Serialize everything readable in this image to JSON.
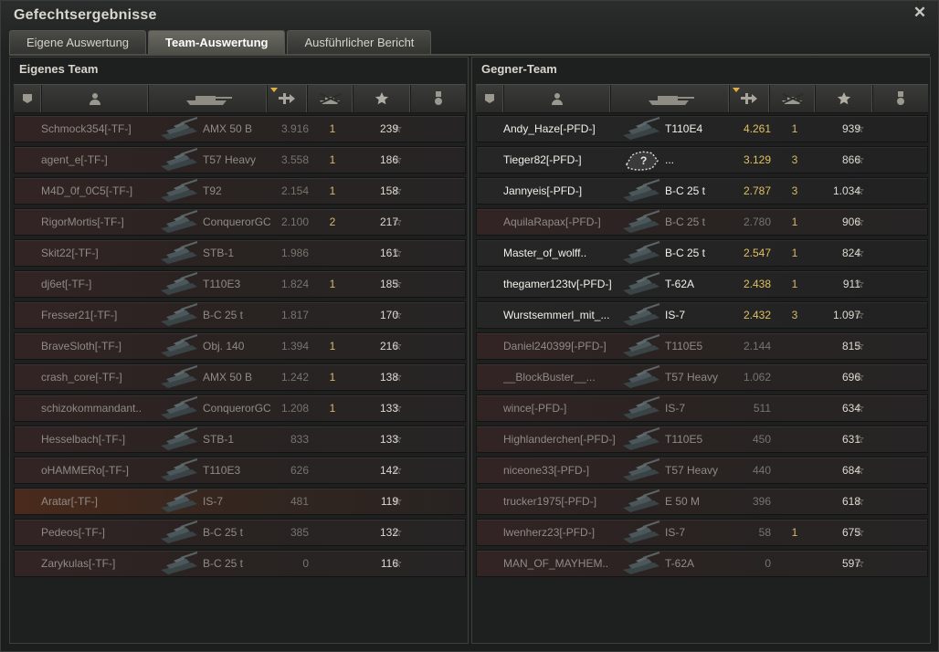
{
  "window": {
    "title": "Gefechtsergebnisse"
  },
  "tabs": [
    {
      "label": "Eigene Auswertung"
    },
    {
      "label": "Team-Auswertung"
    },
    {
      "label": "Ausführlicher Bericht"
    }
  ],
  "active_tab": "Team-Auswertung",
  "icons": {
    "close": "close-icon",
    "columns": [
      "squad-icon",
      "player-icon",
      "tank-icon",
      "damage-icon",
      "kills-icon",
      "xp-star-icon",
      "medal-icon"
    ],
    "row_star": "star-icon"
  },
  "colors": {
    "accent_gold": "#e0c060",
    "sort_indicator": "#e0b040"
  },
  "own_team": {
    "title": "Eigenes Team",
    "sorted_column": "damage",
    "rows": [
      {
        "name": "Schmock354[-TF-]",
        "tank": "AMX 50 B",
        "damage": "3.916",
        "kills": "1",
        "xp": "239",
        "alive": false,
        "self": false
      },
      {
        "name": "agent_e[-TF-]",
        "tank": "T57 Heavy",
        "damage": "3.558",
        "kills": "1",
        "xp": "186",
        "alive": false,
        "self": false
      },
      {
        "name": "M4D_0f_0C5[-TF-]",
        "tank": "T92",
        "damage": "2.154",
        "kills": "1",
        "xp": "158",
        "alive": false,
        "self": false
      },
      {
        "name": "RigorMortis[-TF-]",
        "tank": "ConquerorGC",
        "damage": "2.100",
        "kills": "2",
        "xp": "217",
        "alive": false,
        "self": false
      },
      {
        "name": "Skit22[-TF-]",
        "tank": "STB-1",
        "damage": "1.986",
        "kills": "",
        "xp": "161",
        "alive": false,
        "self": false
      },
      {
        "name": "dj6et[-TF-]",
        "tank": "T110E3",
        "damage": "1.824",
        "kills": "1",
        "xp": "185",
        "alive": false,
        "self": false
      },
      {
        "name": "Fresser21[-TF-]",
        "tank": "B-C 25 t",
        "damage": "1.817",
        "kills": "",
        "xp": "170",
        "alive": false,
        "self": false
      },
      {
        "name": "BraveSloth[-TF-]",
        "tank": "Obj. 140",
        "damage": "1.394",
        "kills": "1",
        "xp": "216",
        "alive": false,
        "self": false
      },
      {
        "name": "crash_core[-TF-]",
        "tank": "AMX 50 B",
        "damage": "1.242",
        "kills": "1",
        "xp": "138",
        "alive": false,
        "self": false
      },
      {
        "name": "schizokommandant..",
        "tank": "ConquerorGC",
        "damage": "1.208",
        "kills": "1",
        "xp": "133",
        "alive": false,
        "self": false
      },
      {
        "name": "Hesselbach[-TF-]",
        "tank": "STB-1",
        "damage": "833",
        "kills": "",
        "xp": "133",
        "alive": false,
        "self": false
      },
      {
        "name": "oHAMMERo[-TF-]",
        "tank": "T110E3",
        "damage": "626",
        "kills": "",
        "xp": "142",
        "alive": false,
        "self": false
      },
      {
        "name": "Aratar[-TF-]",
        "tank": "IS-7",
        "damage": "481",
        "kills": "",
        "xp": "119",
        "alive": false,
        "self": true
      },
      {
        "name": "Pedeos[-TF-]",
        "tank": "B-C 25 t",
        "damage": "385",
        "kills": "",
        "xp": "132",
        "alive": false,
        "self": false
      },
      {
        "name": "Zarykulas[-TF-]",
        "tank": "B-C 25 t",
        "damage": "0",
        "kills": "",
        "xp": "116",
        "alive": false,
        "self": false
      }
    ]
  },
  "enemy_team": {
    "title": "Gegner-Team",
    "sorted_column": "damage",
    "rows": [
      {
        "name": "Andy_Haze[-PFD-]",
        "tank": "T110E4",
        "damage": "4.261",
        "kills": "1",
        "xp": "939",
        "alive": true
      },
      {
        "name": "Tieger82[-PFD-]",
        "tank": "...",
        "damage": "3.129",
        "kills": "3",
        "xp": "866",
        "alive": true,
        "unknown": true
      },
      {
        "name": "Jannyeis[-PFD-]",
        "tank": "B-C 25 t",
        "damage": "2.787",
        "kills": "3",
        "xp": "1.034",
        "alive": true
      },
      {
        "name": "AquilaRapax[-PFD-]",
        "tank": "B-C 25 t",
        "damage": "2.780",
        "kills": "1",
        "xp": "906",
        "alive": false
      },
      {
        "name": "Master_of_wolff..",
        "tank": "B-C 25 t",
        "damage": "2.547",
        "kills": "1",
        "xp": "824",
        "alive": true
      },
      {
        "name": "thegamer123tv[-PFD-]",
        "tank": "T-62A",
        "damage": "2.438",
        "kills": "1",
        "xp": "911",
        "alive": true
      },
      {
        "name": "Wurstsemmerl_mit_...",
        "tank": "IS-7",
        "damage": "2.432",
        "kills": "3",
        "xp": "1.097",
        "alive": true
      },
      {
        "name": "Daniel240399[-PFD-]",
        "tank": "T110E5",
        "damage": "2.144",
        "kills": "",
        "xp": "815",
        "alive": false
      },
      {
        "name": "__BlockBuster__...",
        "tank": "T57 Heavy",
        "damage": "1.062",
        "kills": "",
        "xp": "696",
        "alive": false
      },
      {
        "name": "wince[-PFD-]",
        "tank": "IS-7",
        "damage": "511",
        "kills": "",
        "xp": "634",
        "alive": false
      },
      {
        "name": "Highlanderchen[-PFD-]",
        "tank": "T110E5",
        "damage": "450",
        "kills": "",
        "xp": "631",
        "alive": false
      },
      {
        "name": "niceone33[-PFD-]",
        "tank": "T57 Heavy",
        "damage": "440",
        "kills": "",
        "xp": "684",
        "alive": false
      },
      {
        "name": "trucker1975[-PFD-]",
        "tank": "E 50 M",
        "damage": "396",
        "kills": "",
        "xp": "618",
        "alive": false
      },
      {
        "name": "lwenherz23[-PFD-]",
        "tank": "IS-7",
        "damage": "58",
        "kills": "1",
        "xp": "675",
        "alive": false
      },
      {
        "name": "MAN_OF_MAYHEM..",
        "tank": "T-62A",
        "damage": "0",
        "kills": "",
        "xp": "597",
        "alive": false
      }
    ]
  }
}
